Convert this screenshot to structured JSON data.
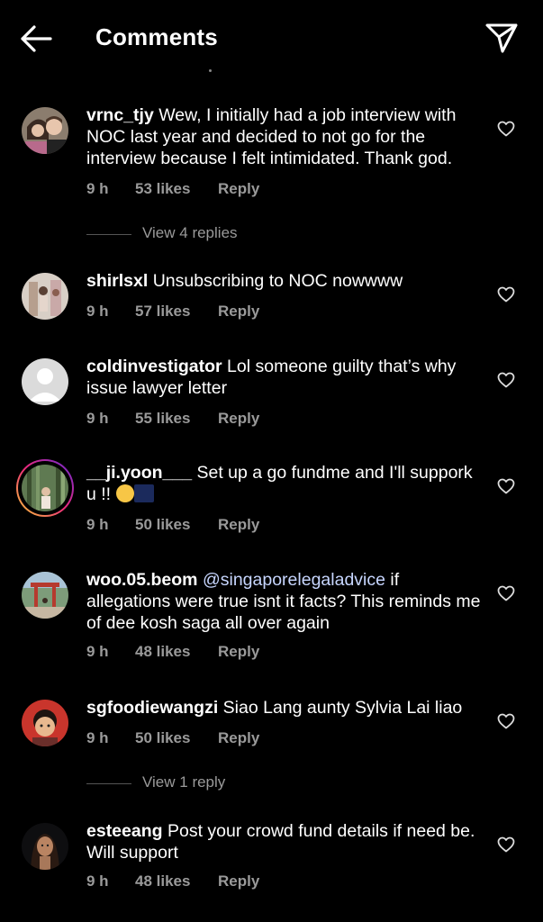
{
  "header": {
    "title": "Comments"
  },
  "comments": [
    {
      "username": "vrnc_tjy",
      "text": "Wew, I initially had a job interview with NOC last year and decided to not go for the interview because I felt intimidated. Thank god.",
      "time": "9 h",
      "likes": "53 likes",
      "reply": "Reply",
      "view_replies": "View 4 replies"
    },
    {
      "username": "shirlsxl",
      "text": "Unsubscribing to NOC nowwww",
      "time": "9 h",
      "likes": "57 likes",
      "reply": "Reply"
    },
    {
      "username": "coldinvestigator",
      "text": "Lol someone guilty that’s why issue lawyer letter",
      "time": "9 h",
      "likes": "55 likes",
      "reply": "Reply"
    },
    {
      "username": "__ji.yoon___",
      "text": "Set up a go fundme and I'll suppork u !!",
      "time": "9 h",
      "likes": "50 likes",
      "reply": "Reply"
    },
    {
      "username": "woo.05.beom",
      "mention": "@singaporelegaladvice",
      "text": "if allegations were true isnt it facts? This reminds me of dee kosh saga all over again",
      "time": "9 h",
      "likes": "48 likes",
      "reply": "Reply"
    },
    {
      "username": "sgfoodiewangzi",
      "text": "Siao Lang aunty Sylvia Lai liao",
      "time": "9 h",
      "likes": "50 likes",
      "reply": "Reply",
      "view_replies": "View 1 reply"
    },
    {
      "username": "esteeang",
      "text": "Post your crowd fund details if need be. Will support",
      "time": "9 h",
      "likes": "48 likes",
      "reply": "Reply"
    }
  ],
  "icons": {
    "back": "arrow-left-icon",
    "send": "paper-plane-icon",
    "like": "heart-outline-icon"
  },
  "colors": {
    "background": "#000000",
    "text": "#ffffff",
    "muted": "#9a9a9a",
    "mention": "#c7d6ff"
  }
}
